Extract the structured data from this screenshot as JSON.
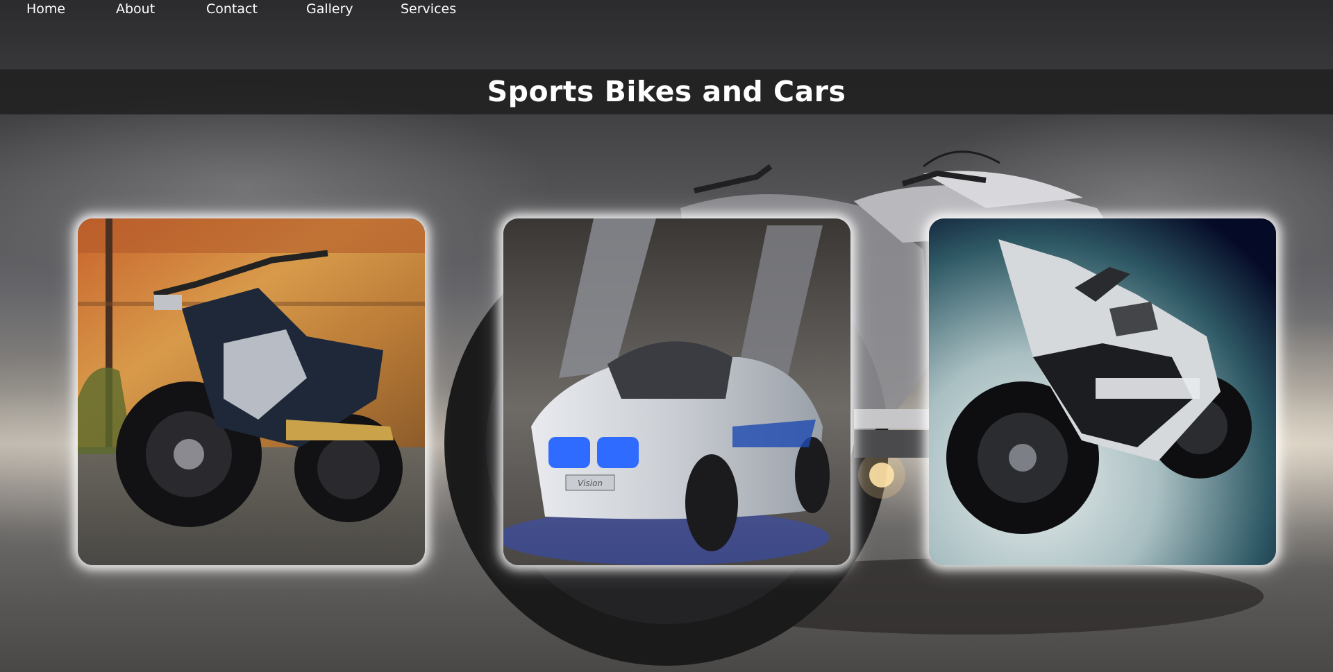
{
  "nav": {
    "items": [
      {
        "label": "Home"
      },
      {
        "label": "About"
      },
      {
        "label": "Contact"
      },
      {
        "label": "Gallery"
      },
      {
        "label": "Services"
      }
    ]
  },
  "banner": {
    "title": "Sports Bikes and Cars"
  },
  "gallery": {
    "cards": [
      {
        "subject": "custom-cruiser-motorcycle",
        "plate_text": ""
      },
      {
        "subject": "concept-sports-car",
        "plate_text": "Vision"
      },
      {
        "subject": "futuristic-sport-motorcycle",
        "plate_text": ""
      }
    ]
  },
  "colors": {
    "nav_text": "#ffffff",
    "banner_bg": "#1e1e1e",
    "card_glow": "#ffffff",
    "accent_blue": "#2f6bff"
  }
}
